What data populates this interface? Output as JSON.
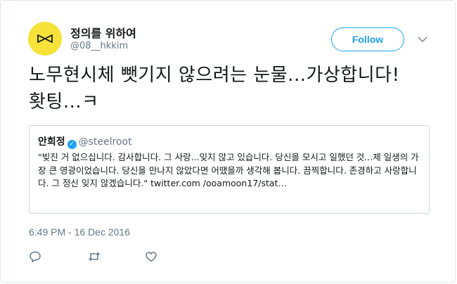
{
  "author": {
    "display_name": "정의를 위하여",
    "handle": "@08__hkkim",
    "avatar_color": "#f7e23a",
    "avatar_icon": "logo-icon"
  },
  "follow_label": "Follow",
  "tweet_text": "노무현시체 뺏기지 않으려는 눈물...가상합니다! 홧팅...ㅋ",
  "quoted": {
    "name": "안희정",
    "verified_icon": "verified-badge-icon",
    "handle": "@steelroot",
    "text": "\"빚진 거 없으십니다. 감사합니다. 그 사랑...잊지 않고 있습니다. 당신을 모시고 일했던 것...제 일생의 가장 큰 영광이었습니다. 당신을 만나지 않았다면 어땠을까 생각해 봅니다. 끔찍합니다. 존경하고 사랑합니다. 그 정신 잊지 않겠습니다.\" twitter.com /ooamoon17/stat…"
  },
  "timestamp": "6:49 PM - 16 Dec 2016",
  "actions": [
    "reply-icon",
    "retweet-icon",
    "like-icon"
  ],
  "colors": {
    "accent": "#1da1f2",
    "muted": "#657786",
    "border": "#e1e8ed"
  }
}
